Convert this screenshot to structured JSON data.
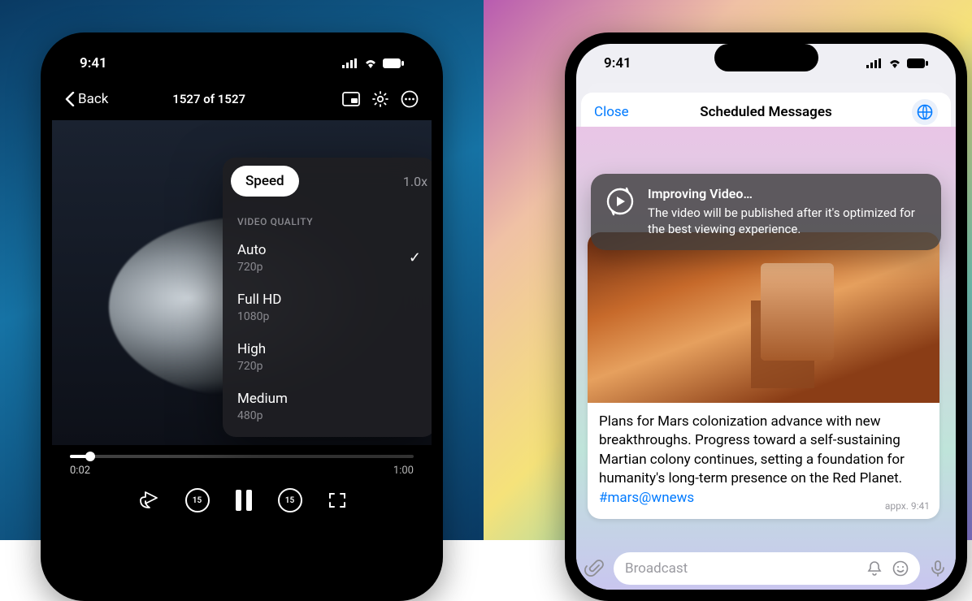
{
  "left": {
    "status": {
      "time": "9:41"
    },
    "nav": {
      "back": "Back",
      "title": "1527 of 1527"
    },
    "popover": {
      "speed_label": "Speed",
      "speed_value": "1.0x",
      "header": "VIDEO QUALITY",
      "items": [
        {
          "label": "Auto",
          "sub": "720p",
          "selected": true
        },
        {
          "label": "Full HD",
          "sub": "1080p",
          "selected": false
        },
        {
          "label": "High",
          "sub": "720p",
          "selected": false
        },
        {
          "label": "Medium",
          "sub": "480p",
          "selected": false
        }
      ]
    },
    "scrub": {
      "elapsed": "0:02",
      "total": "1:00",
      "skip": "15"
    }
  },
  "right": {
    "status": {
      "time": "9:41"
    },
    "sheet": {
      "close": "Close",
      "title": "Scheduled Messages"
    },
    "toast": {
      "title": "Improving Video…",
      "body": "The video will be published after it's optimized for the best viewing experience."
    },
    "message": {
      "text": "Plans for Mars colonization advance with new breakthroughs. Progress toward a self-sustaining Martian colony continues, setting a foundation for humanity's long-term presence on the Red Planet.",
      "tag": "#mars",
      "mention": "@wnews",
      "meta": "appx. 9:41"
    },
    "input": {
      "placeholder": "Broadcast"
    }
  }
}
